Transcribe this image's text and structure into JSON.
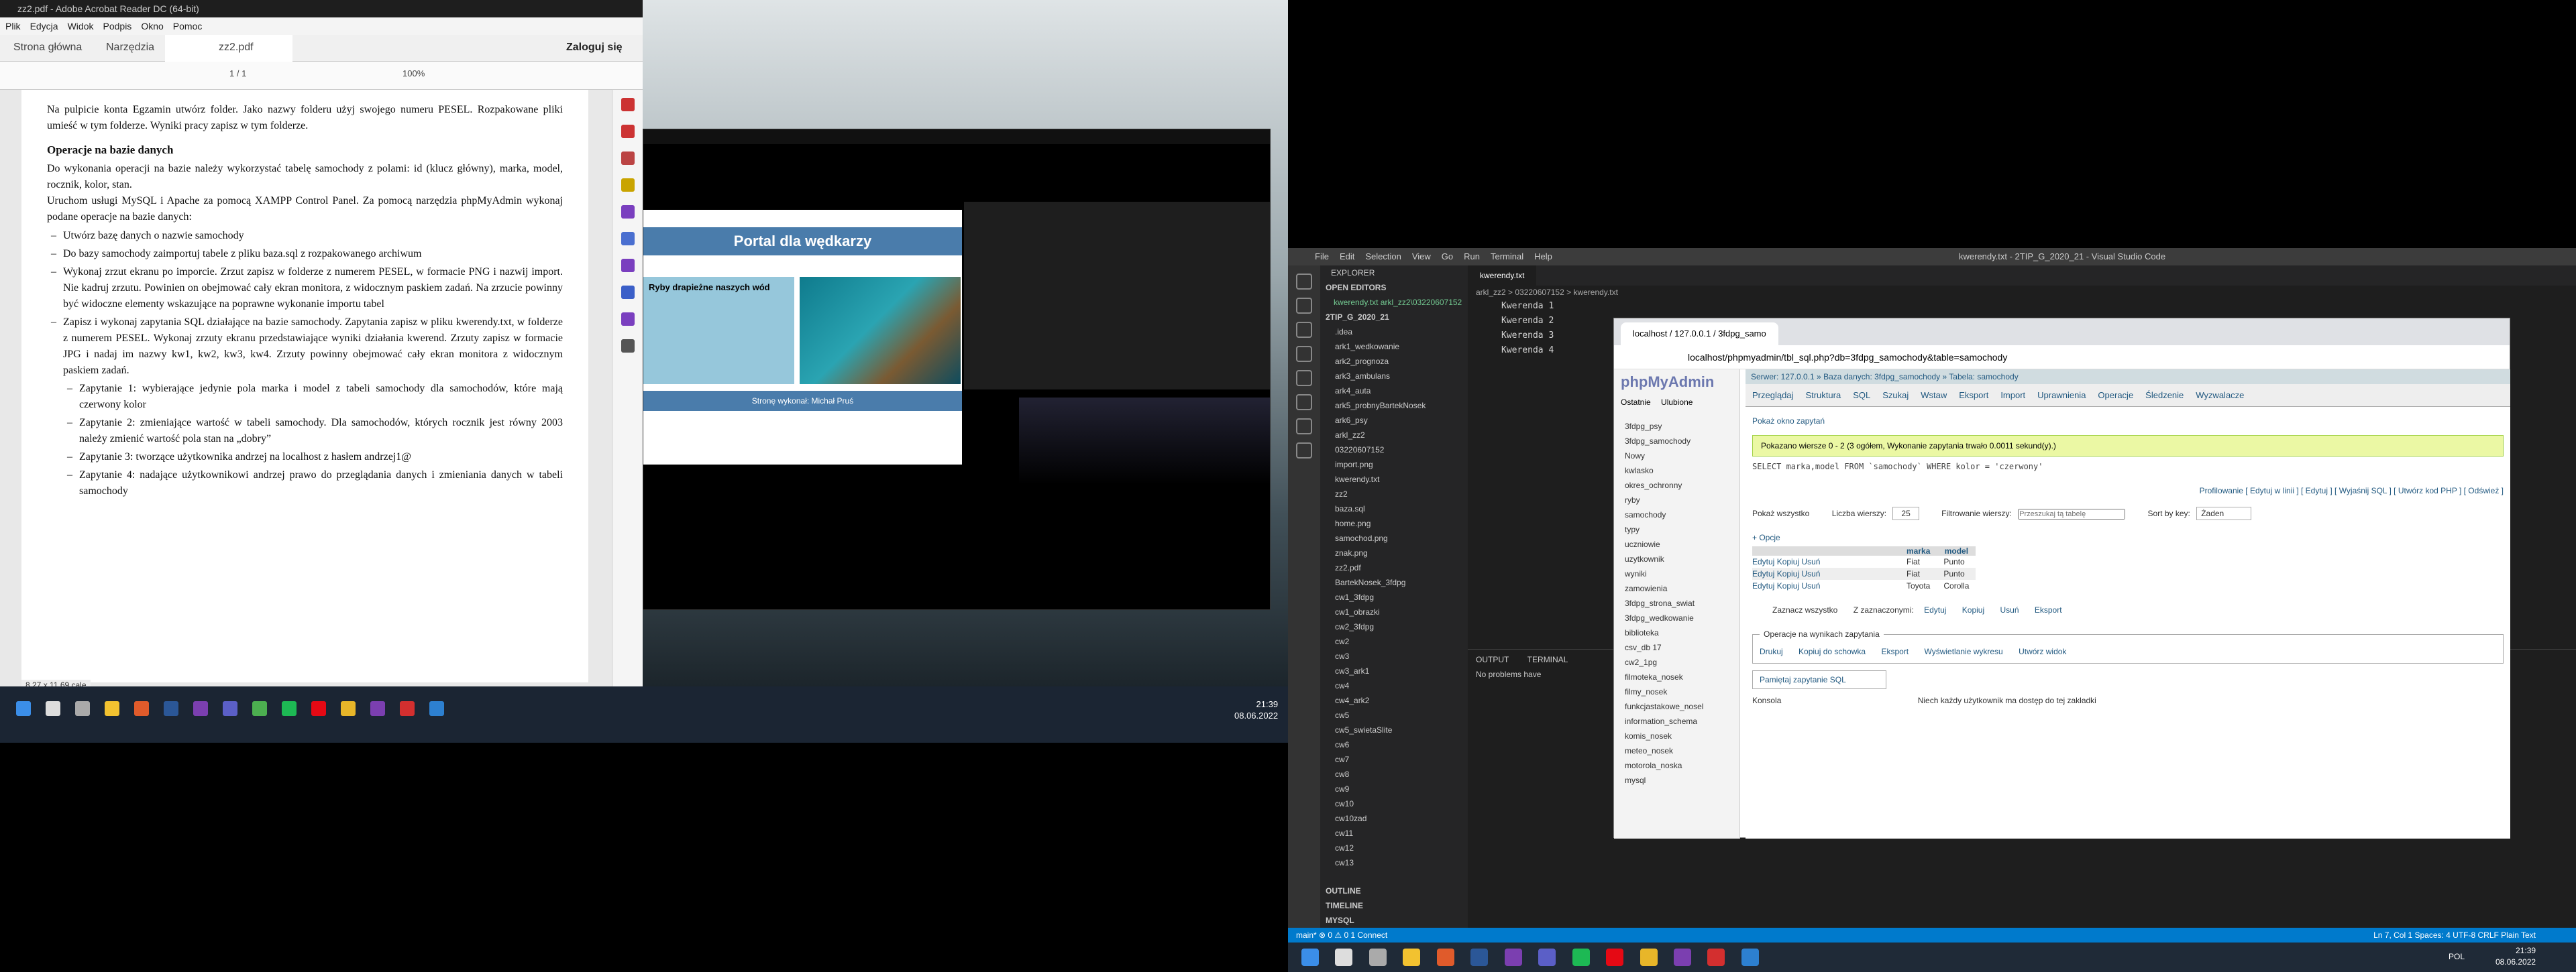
{
  "acrobat": {
    "title": "zz2.pdf - Adobe Acrobat Reader DC (64-bit)",
    "menu": [
      "Plik",
      "Edycja",
      "Widok",
      "Podpis",
      "Okno",
      "Pomoc"
    ],
    "tabs": [
      "Strona główna",
      "Narzędzia",
      "zz2.pdf"
    ],
    "login": "Zaloguj się",
    "page_counter": "1 / 1",
    "zoom": "100%",
    "page_size": "8,27 x 11,69 cale",
    "doc": {
      "intro": "Na pulpicie konta Egzamin utwórz folder. Jako nazwy folderu użyj swojego numeru PESEL. Rozpakowane pliki umieść w tym folderze. Wyniki pracy zapisz w tym folderze.",
      "heading": "Operacje na bazie danych",
      "p1": "Do wykonania operacji na bazie należy wykorzystać tabelę samochody z polami: id (klucz główny), marka, model, rocznik, kolor, stan.",
      "p2": "Uruchom usługi MySQL i Apache za pomocą XAMPP Control Panel. Za pomocą narzędzia phpMyAdmin wykonaj podane operacje na bazie danych:",
      "items": [
        "Utwórz bazę danych o nazwie samochody",
        "Do bazy samochody zaimportuj tabele z pliku baza.sql z rozpakowanego archiwum",
        "Wykonaj zrzut ekranu po imporcie. Zrzut zapisz w folderze z numerem PESEL, w formacie PNG i nazwij import. Nie kadruj zrzutu. Powinien on obejmować cały ekran monitora, z widocznym paskiem zadań. Na zrzucie powinny być widoczne elementy wskazujące na poprawne wykonanie importu tabel",
        "Zapisz i wykonaj zapytania SQL działające na bazie samochody. Zapytania zapisz w pliku kwerendy.txt, w folderze z numerem PESEL. Wykonaj zrzuty ekranu przedstawiające wyniki działania kwerend. Zrzuty zapisz w formacie JPG i nadaj im nazwy kw1, kw2, kw3, kw4. Zrzuty powinny obejmować cały ekran monitora z widocznym paskiem zadań."
      ],
      "subitems": [
        "Zapytanie 1: wybierające jedynie pola marka i model z tabeli samochody dla samochodów, które mają czerwony kolor",
        "Zapytanie 2: zmieniające wartość w tabeli samochody. Dla samochodów, których rocznik jest równy 2003 należy zmienić wartość pola stan na „dobry”",
        "Zapytanie 3: tworzące użytkownika andrzej na localhost z hasłem andrzej1@",
        "Zapytanie 4: nadające użytkownikowi andrzej prawo do przeglądania danych i zmieniania danych w tabeli samochody"
      ]
    }
  },
  "video": {
    "site_title": "Portal dla wędkarzy",
    "site_sub": "Ryby drapieżne naszych wód",
    "site_foot": "Stronę wykonał: Michał Pruś",
    "clock_time": "21:39",
    "clock_date": "08.06.2022"
  },
  "vscode": {
    "title": "kwerendy.txt - 2TIP_G_2020_21 - Visual Studio Code",
    "menu": [
      "File",
      "Edit",
      "Selection",
      "View",
      "Go",
      "Run",
      "Terminal",
      "Help"
    ],
    "explorer": "EXPLORER",
    "open_editors": "OPEN EDITORS",
    "open_file": "kwerendy.txt arkl_zz2\\03220607152",
    "root": "2TIP_G_2020_21",
    "tree": [
      ".idea",
      "ark1_wedkowanie",
      "ark2_prognoza",
      "ark3_ambulans",
      "ark4_auta",
      "ark5_probnyBartekNosek",
      "ark6_psy",
      "arkl_zz2",
      "03220607152",
      "import.png",
      "kwerendy.txt",
      "zz2",
      "baza.sql",
      "home.png",
      "samochod.png",
      "znak.png",
      "zz2.pdf",
      "BartekNosek_3fdpg",
      "cw1_3fdpg",
      "cw1_obrazki",
      "cw2_3fdpg",
      "cw2",
      "cw3",
      "cw3_ark1",
      "cw4",
      "cw4_ark2",
      "cw5",
      "cw5_swietaSlite",
      "cw6",
      "cw7",
      "cw8",
      "cw9",
      "cw10",
      "cw10zad",
      "cw11",
      "cw12",
      "cw13"
    ],
    "outline": "OUTLINE",
    "timeline": "TIMELINE",
    "mysql": "MYSQL",
    "tab": "kwerendy.txt",
    "breadcrumb": "arkl_zz2 > 03220607152 > kwerendy.txt",
    "lines": [
      "Kwerenda 1",
      "Kwerenda 2",
      "Kwerenda 3",
      "Kwerenda 4"
    ],
    "panel_tabs": [
      "OUTPUT",
      "TERMINAL"
    ],
    "problems": "No problems have",
    "status_left": "main*  ⊗ 0 ⚠ 0 1   Connect",
    "status_right": "Ln 7, Col 1   Spaces: 4   UTF-8   CRLF   Plain Text",
    "clock_time": "21:39",
    "clock_date": "08.06.2022",
    "lang": "POL"
  },
  "browser": {
    "tab": "localhost / 127.0.0.1 / 3fdpg_samo",
    "url": "localhost/phpmyadmin/tbl_sql.php?db=3fdpg_samochody&table=samochody",
    "breadcrumb": "Serwer: 127.0.0.1 » Baza danych: 3fdpg_samochody » Tabela: samochody",
    "nav": [
      "Przeglądaj",
      "Struktura",
      "SQL",
      "Szukaj",
      "Wstaw",
      "Eksport",
      "Import",
      "Uprawnienia",
      "Operacje",
      "Śledzenie",
      "Wyzwalacze"
    ],
    "left_tabs": [
      "Ostatnie",
      "Ulubione"
    ],
    "db_tree": [
      "3fdpg_psy",
      "3fdpg_samochody",
      "Nowy",
      "kwlasko",
      "okres_ochronny",
      "ryby",
      "samochody",
      "typy",
      "uczniowie",
      "uzytkownik",
      "wyniki",
      "zamowienia",
      "3fdpg_strona_swiat",
      "3fdpg_wedkowanie",
      "biblioteka",
      "csv_db 17",
      "cw2_1pg",
      "filmoteka_nosek",
      "filmy_nosek",
      "funkcjastakowe_nosel",
      "information_schema",
      "komis_nosek",
      "meteo_nosek",
      "motorola_noska",
      "mysql"
    ],
    "show_query": "Pokaż okno zapytań",
    "success": "Pokazano wiersze 0 - 2 (3 ogółem, Wykonanie zapytania trwało 0.0011 sekund(y).)",
    "sql": "SELECT marka,model FROM `samochody` WHERE kolor = 'czerwony'",
    "profiling": "Profilowanie [ Edytuj w linii ] [ Edytuj ] [ Wyjaśnij SQL ] [ Utwórz kod PHP ] [ Odśwież ]",
    "show_all": "Pokaż wszystko",
    "rows_label": "Liczba wierszy:",
    "rows_value": "25",
    "filter_label": "Filtrowanie wierszy:",
    "filter_placeholder": "Przeszukaj tą tabelę",
    "sort_label": "Sort by key:",
    "sort_value": "Żaden",
    "options": "+ Opcje",
    "columns": [
      "marka",
      "model"
    ],
    "rows": [
      [
        "Fiat",
        "Punto"
      ],
      [
        "Fiat",
        "Punto"
      ],
      [
        "Toyota",
        "Corolla"
      ]
    ],
    "row_actions": [
      "Edytuj",
      "Kopiuj",
      "Usuń"
    ],
    "check_all": "Zaznacz wszystko",
    "with_selected": "Z zaznaczonymi:",
    "bulk_actions": [
      "Edytuj",
      "Kopiuj",
      "Usuń",
      "Eksport"
    ],
    "ops_title": "Operacje na wynikach zapytania",
    "ops": [
      "Drukuj",
      "Kopiuj do schowka",
      "Eksport",
      "Wyświetlanie wykresu",
      "Utwórz widok"
    ],
    "bookmark": "Pamiętaj zapytanie SQL",
    "console": "Konsola",
    "footnote": "Niech każdy użytkownik ma dostęp do tej zakładki"
  }
}
